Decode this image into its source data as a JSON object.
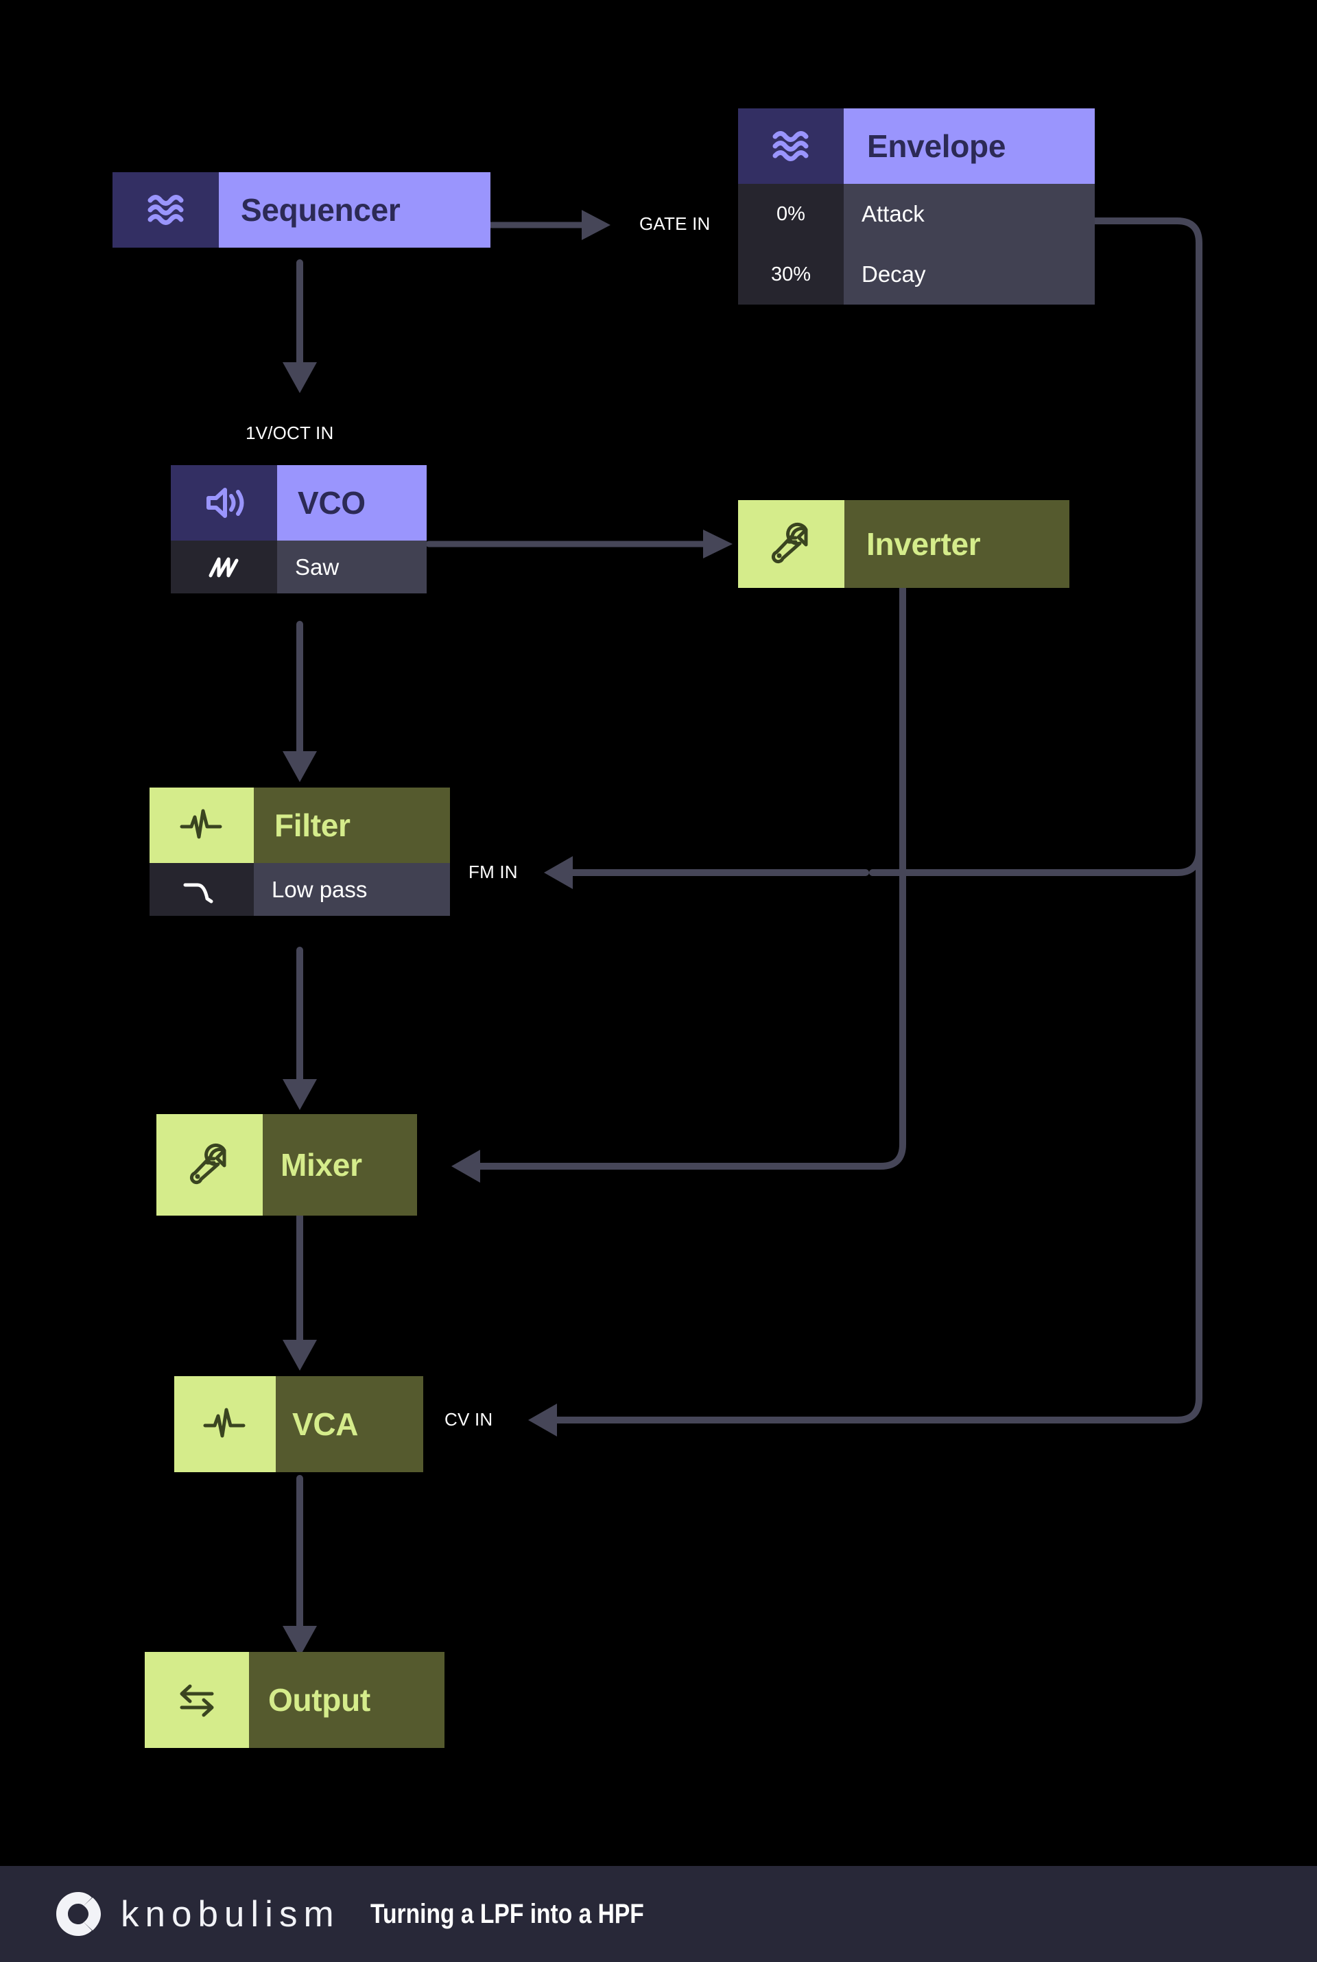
{
  "diagram": {
    "title": "Turning a LPF into a HPF",
    "background": "#000000",
    "modules": [
      {
        "id": "sequencer",
        "name": "Sequencer",
        "theme": "purple",
        "icon": "waves-icon",
        "params": []
      },
      {
        "id": "envelope",
        "name": "Envelope",
        "theme": "purple",
        "icon": "waves-icon",
        "params": [
          {
            "value": "0%",
            "label": "Attack"
          },
          {
            "value": "30%",
            "label": "Decay"
          }
        ]
      },
      {
        "id": "vco",
        "name": "VCO",
        "theme": "purple",
        "icon": "speaker-icon",
        "params": [
          {
            "value": "",
            "icon": "saw-wave-icon",
            "label": "Saw"
          }
        ]
      },
      {
        "id": "inverter",
        "name": "Inverter",
        "theme": "green",
        "icon": "wrench-icon",
        "params": []
      },
      {
        "id": "filter",
        "name": "Filter",
        "theme": "green",
        "icon": "pulse-icon",
        "params": [
          {
            "value": "",
            "icon": "lowpass-curve-icon",
            "label": "Low pass"
          }
        ]
      },
      {
        "id": "mixer",
        "name": "Mixer",
        "theme": "green",
        "icon": "wrench-icon",
        "params": []
      },
      {
        "id": "vca",
        "name": "VCA",
        "theme": "green",
        "icon": "pulse-icon",
        "params": []
      },
      {
        "id": "output",
        "name": "Output",
        "theme": "green",
        "icon": "exchange-arrows-icon",
        "params": []
      }
    ],
    "connections": [
      {
        "id": "seq-to-envelope",
        "label": "GATE IN",
        "from": "sequencer",
        "to": "envelope"
      },
      {
        "id": "seq-to-vco",
        "label": "1V/OCT IN",
        "from": "sequencer",
        "to": "vco"
      },
      {
        "id": "vco-to-inverter",
        "label": "",
        "from": "vco",
        "to": "inverter"
      },
      {
        "id": "vco-to-filter",
        "label": "",
        "from": "vco",
        "to": "filter"
      },
      {
        "id": "env-to-filter",
        "label": "FM IN",
        "from": "envelope",
        "to": "filter"
      },
      {
        "id": "inv-to-mixer",
        "label": "",
        "from": "inverter",
        "to": "mixer"
      },
      {
        "id": "filter-to-mixer",
        "label": "",
        "from": "filter",
        "to": "mixer"
      },
      {
        "id": "mixer-to-vca",
        "label": "",
        "from": "mixer",
        "to": "vca"
      },
      {
        "id": "env-to-vca",
        "label": "CV IN",
        "from": "envelope",
        "to": "vca"
      },
      {
        "id": "vca-to-output",
        "label": "",
        "from": "vca",
        "to": "output"
      }
    ],
    "wire_color": "#464658"
  },
  "footer": {
    "brand": "knobulism",
    "caption": "Turning a LPF into a HPF",
    "background": "#282838"
  },
  "colors": {
    "purple_icon_bg": "#332f63",
    "purple_title_bg": "#9a95fd",
    "purple_title_fg": "#2c2a55",
    "green_icon_bg": "#d5ec8b",
    "green_title_bg": "#555a2e",
    "green_title_fg": "#d5ec8b",
    "param_value_bg": "#26252e",
    "param_label_bg": "#414152",
    "wire": "#464658"
  }
}
